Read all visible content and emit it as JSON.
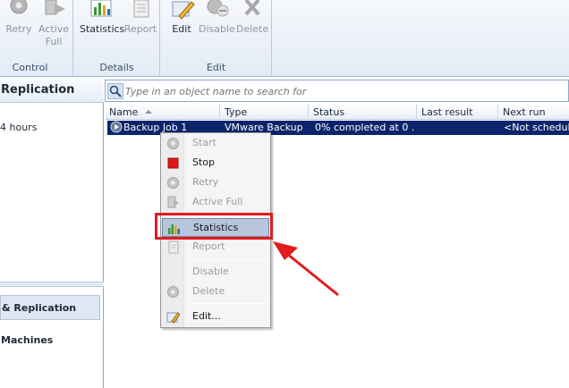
{
  "ribbon": {
    "control": {
      "label": "Control",
      "buttons": [
        {
          "label_line1": "Retry",
          "label_line2": "",
          "icon": "retry-gear-icon",
          "enabled": false
        },
        {
          "label_line1": "Active",
          "label_line2": "Full",
          "icon": "active-full-icon",
          "enabled": false
        }
      ]
    },
    "details": {
      "label": "Details",
      "buttons": [
        {
          "label": "Statistics",
          "icon": "statistics-icon",
          "enabled": true
        },
        {
          "label": "Report",
          "icon": "report-icon",
          "enabled": false
        }
      ]
    },
    "edit": {
      "label": "Edit",
      "buttons": [
        {
          "label": "Edit",
          "icon": "edit-icon",
          "enabled": true
        },
        {
          "label": "Disable",
          "icon": "disable-icon",
          "enabled": false
        },
        {
          "label": "Delete",
          "icon": "delete-icon",
          "enabled": false
        }
      ]
    }
  },
  "sidebar": {
    "header": "Replication",
    "hours_text": "4 hours",
    "nav": [
      {
        "label": "& Replication",
        "selected": true
      },
      {
        "label": "Machines",
        "selected": false
      }
    ]
  },
  "search": {
    "placeholder": "Type in an object name to search for"
  },
  "grid": {
    "columns": [
      "Name",
      "Type",
      "Status",
      "Last result",
      "Next run"
    ],
    "rows": [
      {
        "name": "Backup Job 1",
        "type": "VMware Backup",
        "status": "0% completed at 0 ...",
        "last_result": "",
        "next_run": "<Not scheduled"
      }
    ]
  },
  "context_menu": {
    "items": [
      {
        "label": "Start",
        "icon": "start-gear-icon",
        "enabled": false
      },
      {
        "label": "Stop",
        "icon": "stop-icon",
        "enabled": true
      },
      {
        "label": "Retry",
        "icon": "retry-gear-icon",
        "enabled": false
      },
      {
        "label": "Active Full",
        "icon": "active-full-icon",
        "enabled": false
      },
      {
        "label": "Statistics",
        "icon": "statistics-icon",
        "enabled": true,
        "highlighted": true
      },
      {
        "label": "Report",
        "icon": "report-icon",
        "enabled": false
      },
      {
        "label": "Disable",
        "icon": "",
        "enabled": false
      },
      {
        "label": "Delete",
        "icon": "delete-gear-icon",
        "enabled": false
      },
      {
        "label": "Edit...",
        "icon": "edit-icon",
        "enabled": true
      }
    ]
  },
  "colors": {
    "selection": "#0c246b",
    "annotation": "#e21c1c",
    "menu_highlight": "#b7c5dd"
  }
}
